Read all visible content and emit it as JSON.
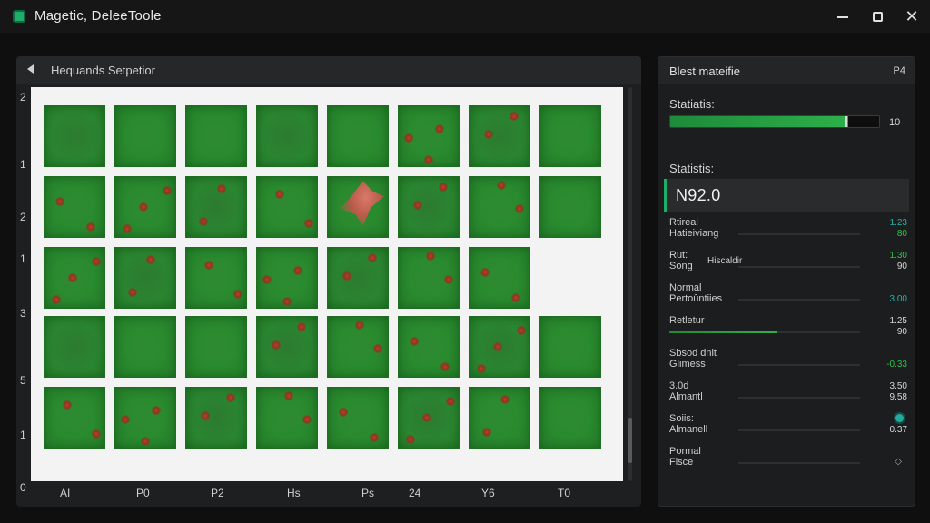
{
  "window": {
    "title": "Magetic, DeleeToole",
    "app_icon": "app-icon",
    "accent": "#1fae6a"
  },
  "left_panel": {
    "title": "Hequands Setpetior",
    "back_icon": "back-arrow-icon",
    "y_labels": [
      "2",
      "1",
      "2",
      "1",
      "3",
      "5",
      "1",
      "0"
    ],
    "x_labels": [
      "AI",
      "P0",
      "P2",
      "Hs",
      "Ps",
      "24",
      "Y6",
      "T0"
    ]
  },
  "grid": {
    "rows": [
      [
        "plain",
        "plain",
        "plain",
        "plain",
        "plain",
        "spots",
        "spots",
        "plain"
      ],
      [
        "spots",
        "spots",
        "spots",
        "spots",
        "blob",
        "spots",
        "spots",
        "plain"
      ],
      [
        "spots",
        "spots",
        "spots",
        "spots",
        "spots",
        "spots",
        "spots",
        "empty"
      ],
      [
        "plain",
        "plain",
        "plain",
        "spots",
        "spots",
        "spots",
        "spots",
        "plain"
      ],
      [
        "spots",
        "spots",
        "spots",
        "spots",
        "spots",
        "spots",
        "spots",
        "plain"
      ]
    ],
    "tile_color": "#2a8a2e",
    "spot_color": "#c0392b"
  },
  "right_panel": {
    "title": "Blest mateifie",
    "badge": "P4",
    "section1_label": "Statiatis:",
    "progress": {
      "fraction": 0.85,
      "value_label": "10",
      "color": "#2db04a"
    },
    "section2_label": "Statistis:",
    "big_value": "N92.0",
    "stats": [
      {
        "name1": "Rtireal",
        "name2": "Hatieiviang",
        "val1": "1.23",
        "val2": "80",
        "val1_color": "cyan",
        "val2_color": "green",
        "fill": 0
      },
      {
        "name1": "Rut:",
        "name2": "Song",
        "note": "Hiscaldir",
        "val1": "1.30",
        "val2": "90",
        "val1_color": "green",
        "val2_color": "white",
        "fill": 0
      },
      {
        "name1": "Normal",
        "name2": "Pertoûntiies",
        "val1": "",
        "val2": "3.00",
        "val1_color": "white",
        "val2_color": "cyan",
        "fill": 0
      },
      {
        "name1": "Retletur",
        "name2": "",
        "val1": "1.25",
        "val2": "90",
        "val1_color": "white",
        "val2_color": "white",
        "fill": 0.45
      },
      {
        "name1": "Sbsod dnit",
        "name2": "Glimess",
        "val1": "",
        "val2": "-0.33",
        "val1_color": "white",
        "val2_color": "green",
        "fill": 0
      },
      {
        "name1": "3.0d",
        "name2": "Almantl",
        "val1": "3.50",
        "val2": "9.58",
        "val1_color": "white",
        "val2_color": "white",
        "fill": 0
      },
      {
        "name1": "Soiis:",
        "name2": "Almanell",
        "val1": "",
        "val2": "0.37",
        "val1_color": "white",
        "val2_color": "white",
        "fill": 0,
        "toggle": true
      },
      {
        "name1": "Pormal",
        "name2": "Fisce",
        "val1": "",
        "val2": "",
        "val1_color": "white",
        "val2_color": "white",
        "fill": 0,
        "chevron": true
      }
    ]
  }
}
